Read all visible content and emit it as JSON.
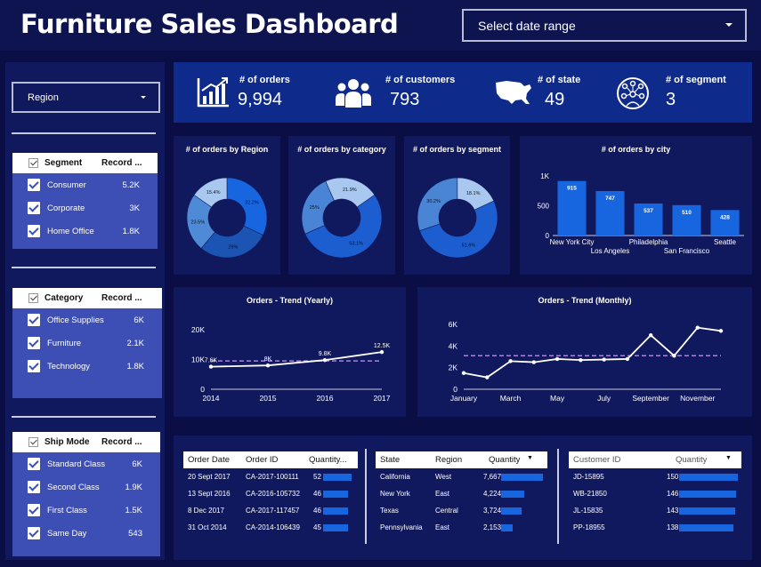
{
  "header": {
    "title": "Furniture Sales Dashboard",
    "date_range_placeholder": "Select date range"
  },
  "filters": {
    "region_label": "Region",
    "segment": {
      "header": "Segment",
      "record": "Record ...",
      "items": [
        {
          "label": "Consumer",
          "value": "5.2K"
        },
        {
          "label": "Corporate",
          "value": "3K"
        },
        {
          "label": "Home Office",
          "value": "1.8K"
        }
      ]
    },
    "category": {
      "header": "Category",
      "record": "Record ...",
      "items": [
        {
          "label": "Office Supplies",
          "value": "6K"
        },
        {
          "label": "Furniture",
          "value": "2.1K"
        },
        {
          "label": "Technology",
          "value": "1.8K"
        }
      ]
    },
    "shipmode": {
      "header": "Ship Mode",
      "record": "Record ...",
      "items": [
        {
          "label": "Standard Class",
          "value": "6K"
        },
        {
          "label": "Second Class",
          "value": "1.9K"
        },
        {
          "label": "First Class",
          "value": "1.5K"
        },
        {
          "label": "Same Day",
          "value": "543"
        }
      ]
    }
  },
  "kpis": [
    {
      "label": "# of orders",
      "value": "9,994",
      "icon": "growth-chart-icon"
    },
    {
      "label": "# of customers",
      "value": "793",
      "icon": "people-icon"
    },
    {
      "label": "# of state",
      "value": "49",
      "icon": "usa-map-icon"
    },
    {
      "label": "# of segment",
      "value": "3",
      "icon": "network-icon"
    }
  ],
  "chart_data": [
    {
      "type": "pie",
      "title": "# of orders by Region",
      "slices": [
        {
          "label": "32.2%",
          "value": 32.2
        },
        {
          "label": "29%",
          "value": 29
        },
        {
          "label": "23.5%",
          "value": 23.5
        },
        {
          "label": "15.4%",
          "value": 15.4
        }
      ]
    },
    {
      "type": "pie",
      "title": "# of orders by category",
      "slices": [
        {
          "label": "53.1%",
          "value": 53.1
        },
        {
          "label": "25%",
          "value": 25
        },
        {
          "label": "21.9%",
          "value": 21.9
        }
      ]
    },
    {
      "type": "pie",
      "title": "# of orders by segment",
      "slices": [
        {
          "label": "51.6%",
          "value": 51.6
        },
        {
          "label": "30.2%",
          "value": 30.2
        },
        {
          "label": "18.1%",
          "value": 18.1
        }
      ]
    },
    {
      "type": "bar",
      "title": "# of orders by city",
      "categories": [
        "New York City",
        "Los Angeles",
        "Philadelphia",
        "San Francisco",
        "Seattle"
      ],
      "values": [
        915,
        747,
        537,
        510,
        428
      ],
      "data_labels": [
        "915",
        "747",
        "537",
        "510",
        "428"
      ],
      "yticks": [
        "0",
        "500",
        "1K"
      ],
      "ylim": [
        0,
        1000
      ]
    },
    {
      "type": "line",
      "title": "Orders - Trend (Yearly)",
      "x": [
        "2014",
        "2015",
        "2016",
        "2017"
      ],
      "values": [
        7580,
        8000,
        9800,
        12500
      ],
      "data_labels": [
        "7.6K",
        "8K",
        "9.8K",
        "12.5K"
      ],
      "average": 9500,
      "yticks": [
        "0",
        "10K",
        "20K"
      ],
      "ylim": [
        0,
        20000
      ]
    },
    {
      "type": "line",
      "title": "Orders - Trend (Monthly)",
      "x": [
        "January",
        "February",
        "March",
        "April",
        "May",
        "June",
        "July",
        "August",
        "September",
        "October",
        "November",
        "December"
      ],
      "xtick_labels": [
        "January",
        "",
        "March",
        "",
        "May",
        "",
        "July",
        "",
        "September",
        "",
        "November",
        ""
      ],
      "values": [
        1500,
        1100,
        2600,
        2500,
        2800,
        2700,
        2750,
        2800,
        5000,
        3100,
        5700,
        5400
      ],
      "average": 3100,
      "yticks": [
        "0",
        "2K",
        "4K",
        "6K"
      ],
      "ylim": [
        0,
        6000
      ]
    }
  ],
  "tables": {
    "orders": {
      "headers": [
        "Order Date",
        "Order ID",
        "Quantity..."
      ],
      "rows": [
        {
          "date": "20 Sept 2017",
          "id": "CA-2017-100111",
          "qty": "52",
          "q": 52
        },
        {
          "date": "13 Sept 2016",
          "id": "CA-2016-105732",
          "qty": "46",
          "q": 46
        },
        {
          "date": "8 Dec 2017",
          "id": "CA-2017-117457",
          "qty": "46",
          "q": 46
        },
        {
          "date": "31 Oct 2014",
          "id": "CA-2014-106439",
          "qty": "45",
          "q": 45
        }
      ]
    },
    "states": {
      "headers": [
        "State",
        "Region",
        "Quantity"
      ],
      "rows": [
        {
          "state": "California",
          "region": "West",
          "qty": "7,667",
          "q": 7667
        },
        {
          "state": "New York",
          "region": "East",
          "qty": "4,224",
          "q": 4224
        },
        {
          "state": "Texas",
          "region": "Central",
          "qty": "3,724",
          "q": 3724
        },
        {
          "state": "Pennsylvania",
          "region": "East",
          "qty": "2,153",
          "q": 2153
        }
      ]
    },
    "customers": {
      "headers": [
        "Customer ID",
        "Quantity"
      ],
      "rows": [
        {
          "id": "JD-15895",
          "qty": "150",
          "q": 150
        },
        {
          "id": "WB-21850",
          "qty": "146",
          "q": 146
        },
        {
          "id": "JL-15835",
          "qty": "143",
          "q": 143
        },
        {
          "id": "PP-18955",
          "qty": "138",
          "q": 138
        }
      ]
    }
  },
  "colors": {
    "background": "#0b0d45",
    "panel": "#0e2a8a",
    "accent": "#1766e0",
    "filter": "#3d4fb5"
  }
}
